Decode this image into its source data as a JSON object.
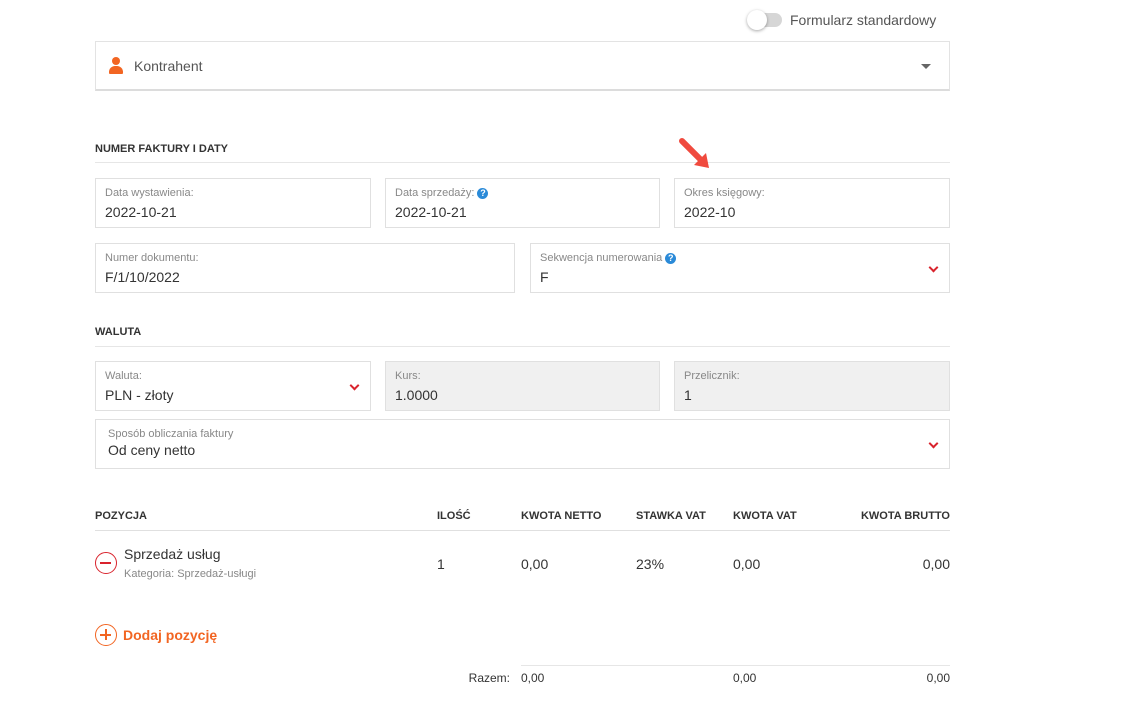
{
  "toggle": {
    "label": "Formularz standardowy",
    "checked": false
  },
  "contractor": {
    "label": "Kontrahent",
    "icon": "person-icon",
    "icon_color": "#f26522"
  },
  "section_invoice": {
    "title": "NUMER FAKTURY I DATY",
    "issue_date": {
      "label": "Data wystawienia:",
      "value": "2022-10-21"
    },
    "sale_date": {
      "label": "Data sprzedaży:",
      "value": "2022-10-21"
    },
    "accounting_period": {
      "label": "Okres księgowy:",
      "value": "2022-10"
    },
    "document_number": {
      "label": "Numer dokumentu:",
      "value": "F/1/10/2022"
    },
    "numbering_sequence": {
      "label": "Sekwencja numerowania",
      "value": "F"
    }
  },
  "section_currency": {
    "title": "WALUTA",
    "currency": {
      "label": "Waluta:",
      "value": "PLN - złoty"
    },
    "rate": {
      "label": "Kurs:",
      "value": "1.0000"
    },
    "converter": {
      "label": "Przelicznik:",
      "value": "1"
    },
    "calc_method": {
      "label": "Sposób obliczania faktury",
      "value": "Od ceny netto"
    }
  },
  "table": {
    "headers": {
      "position": "POZYCJA",
      "quantity": "ILOŚĆ",
      "net": "KWOTA NETTO",
      "vat_rate": "STAWKA VAT",
      "vat": "KWOTA VAT",
      "gross": "KWOTA BRUTTO"
    },
    "rows": [
      {
        "name": "Sprzedaż usług",
        "category": "Kategoria: Sprzedaż-usługi",
        "quantity": "1",
        "net": "0,00",
        "vat_rate": "23%",
        "vat": "0,00",
        "gross": "0,00"
      }
    ],
    "add_label": "Dodaj pozycję",
    "totals": {
      "label": "Razem:",
      "net": "0,00",
      "vat": "0,00",
      "gross": "0,00"
    }
  },
  "colors": {
    "accent": "#f26522",
    "danger": "#d9232d",
    "help": "#2a8ad8"
  }
}
